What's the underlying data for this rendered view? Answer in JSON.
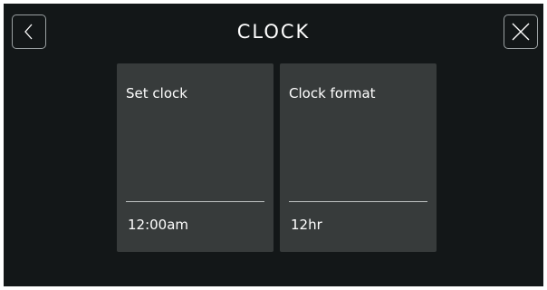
{
  "header": {
    "title": "CLOCK",
    "back_icon": "chevron-left-icon",
    "close_icon": "close-icon"
  },
  "cards": [
    {
      "label": "Set clock",
      "value": "12:00am"
    },
    {
      "label": "Clock format",
      "value": "12hr"
    }
  ],
  "colors": {
    "background": "#131718",
    "card": "#373b3b",
    "text": "#ffffff",
    "border": "#9aa0a2"
  }
}
